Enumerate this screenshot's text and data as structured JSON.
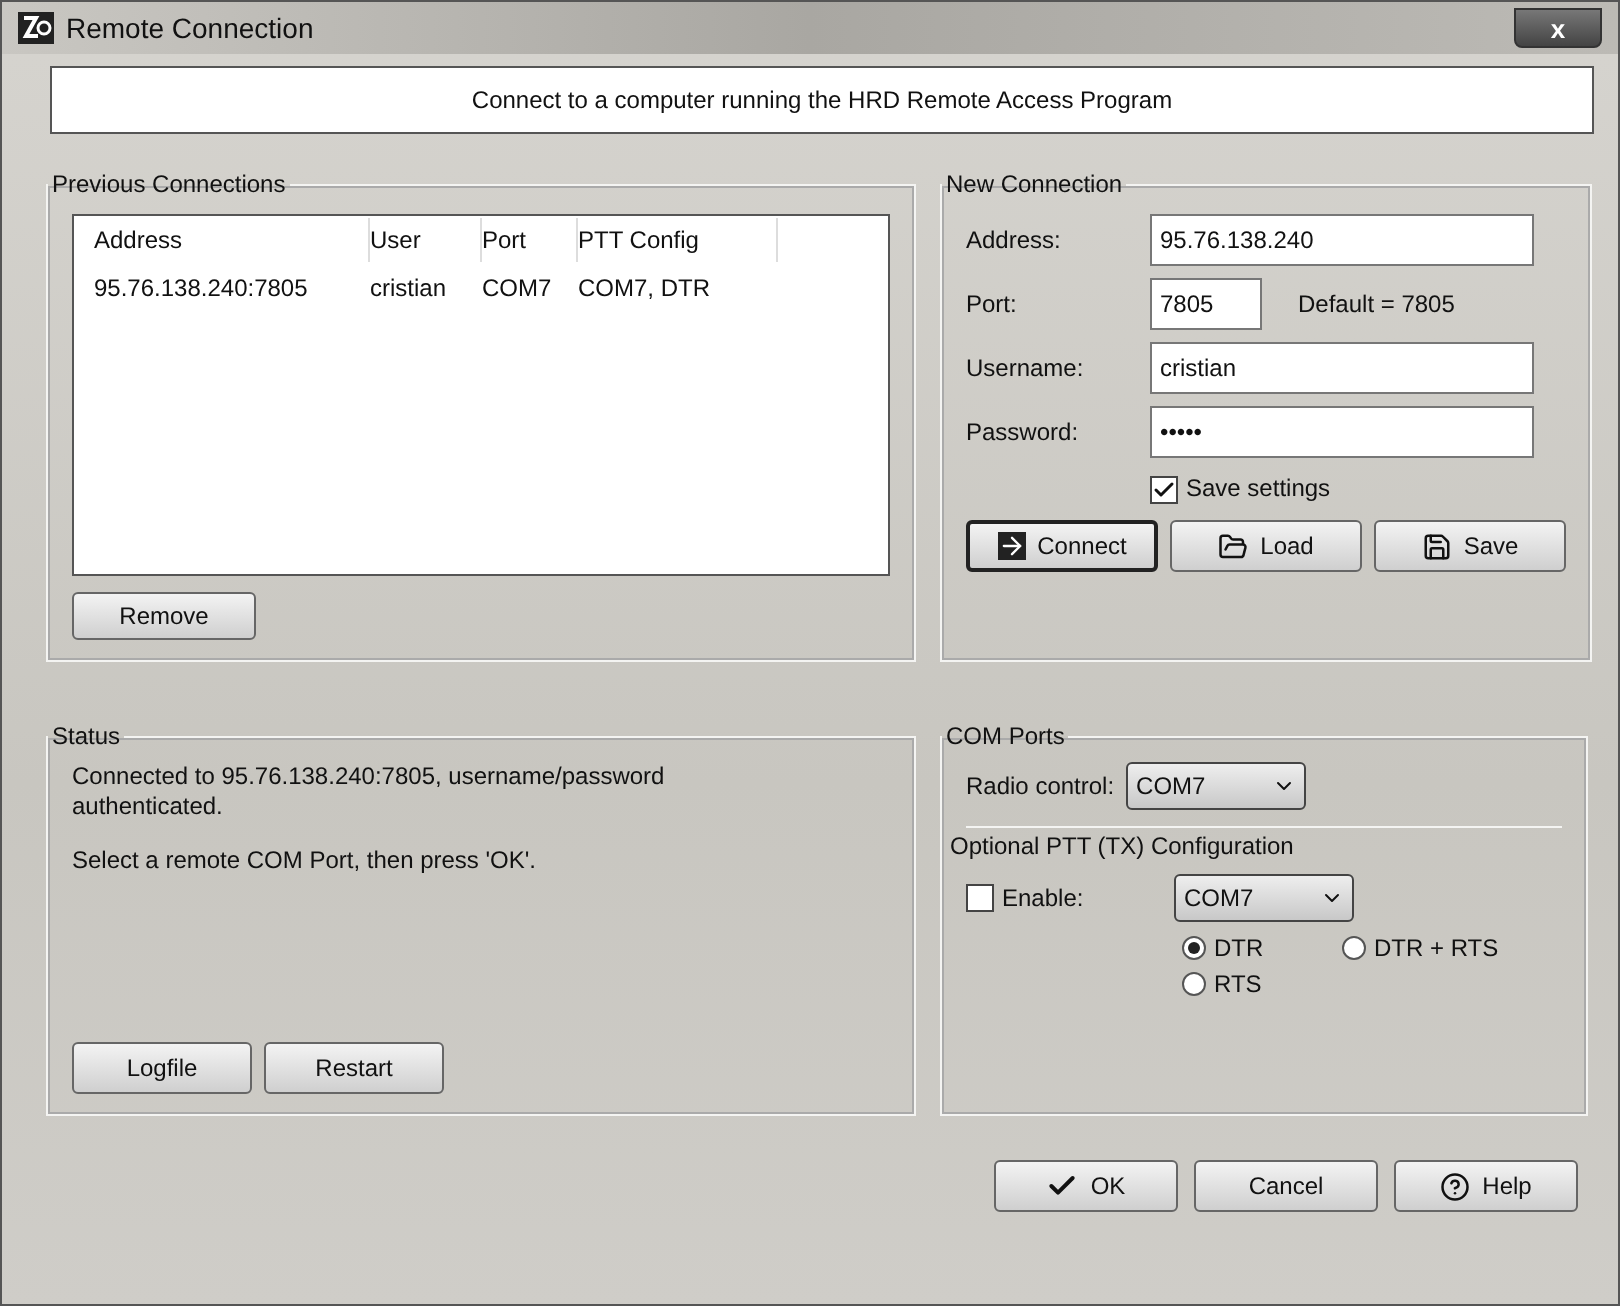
{
  "window": {
    "title": "Remote Connection",
    "close": "x"
  },
  "banner": "Connect to a computer running the HRD Remote Access Program",
  "previous_connections": {
    "title": "Previous Connections",
    "columns": [
      "Address",
      "User",
      "Port",
      "PTT Config"
    ],
    "rows": [
      {
        "cells": [
          "95.76.138.240:7805",
          "cristian",
          "COM7",
          "COM7, DTR"
        ],
        "selected": false
      }
    ],
    "remove_button": "Remove"
  },
  "new_connection": {
    "title": "New Connection",
    "fields": [
      {
        "label": "Address:",
        "value": "95.76.138.240",
        "kind": "wide"
      },
      {
        "label": "Port:",
        "value": "7805",
        "kind": "short",
        "hint": "Default = 7805"
      },
      {
        "label": "Username:",
        "value": "cristian",
        "kind": "wide"
      },
      {
        "label": "Password:",
        "value": "•••••",
        "kind": "wide"
      }
    ],
    "save_settings": {
      "label": "Save settings",
      "checked": true
    },
    "buttons": [
      {
        "label": "Connect",
        "kind": "connect",
        "default": true
      },
      {
        "label": "Load",
        "kind": "load",
        "default": false
      },
      {
        "label": "Save",
        "kind": "save",
        "default": false
      }
    ]
  },
  "status": {
    "title": "Status",
    "lines": [
      "Connected to 95.76.138.240:7805, username/password authenticated.",
      "Select a remote COM Port, then press 'OK'."
    ],
    "buttons": [
      "Logfile",
      "Restart"
    ]
  },
  "com_ports": {
    "title": "COM Ports",
    "radio_label": "Radio control:",
    "radio_value": "COM7",
    "ptt": {
      "title": "Optional PTT (TX) Configuration",
      "enable": {
        "label": "Enable:",
        "checked": false
      },
      "port": "COM7",
      "options": [
        {
          "label": "DTR",
          "selected": true
        },
        {
          "label": "DTR + RTS",
          "selected": false
        },
        {
          "label": "RTS",
          "selected": false
        }
      ]
    }
  },
  "footer_buttons": [
    {
      "label": "OK",
      "kind": "check"
    },
    {
      "label": "Cancel",
      "kind": "plain"
    },
    {
      "label": "Help",
      "kind": "help"
    }
  ]
}
